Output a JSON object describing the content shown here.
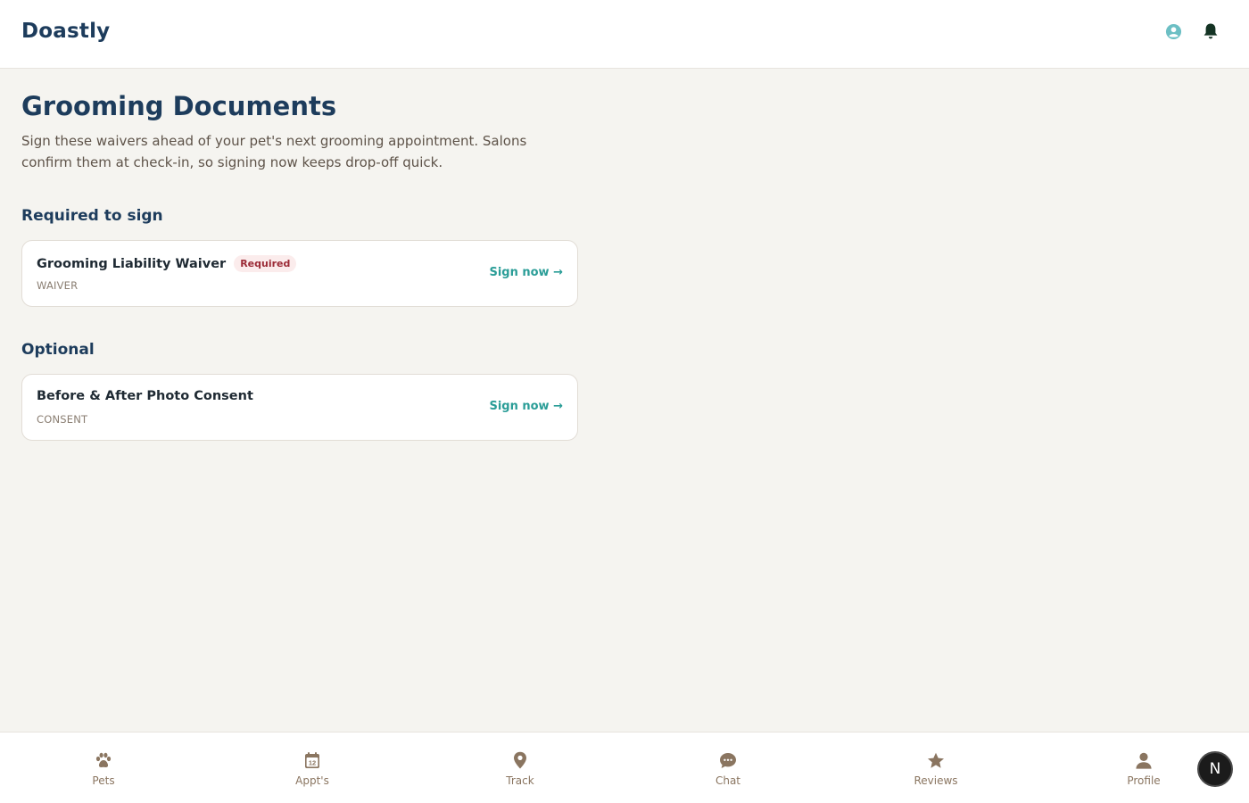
{
  "app": {
    "brand": "Doastly"
  },
  "header_icons": {
    "account": "account-circle-icon",
    "notifications": "bell-icon"
  },
  "page": {
    "title": "Grooming Documents",
    "subtitle": "Sign these waivers ahead of your pet's next grooming appointment. Salons confirm them at check-in, so signing now keeps drop-off quick."
  },
  "sections": {
    "required": {
      "heading": "Required to sign",
      "doc": {
        "title": "Grooming Liability Waiver",
        "badge": "Required",
        "type": "WAIVER",
        "action": "Sign now →"
      }
    },
    "optional": {
      "heading": "Optional",
      "doc": {
        "title": "Before & After Photo Consent",
        "type": "CONSENT",
        "action": "Sign now →"
      }
    }
  },
  "nav": {
    "items": [
      {
        "label": "Pets",
        "icon": "paw-icon"
      },
      {
        "label": "Appt's",
        "icon": "calendar-icon"
      },
      {
        "label": "Track",
        "icon": "location-pin-icon"
      },
      {
        "label": "Chat",
        "icon": "chat-bubble-icon"
      },
      {
        "label": "Reviews",
        "icon": "star-icon"
      },
      {
        "label": "Profile",
        "icon": "person-icon"
      }
    ],
    "calendar_day": "12"
  },
  "floating_button": {
    "label": "N"
  },
  "colors": {
    "brand_navy": "#1d3c5c",
    "accent_teal": "#2a9d97",
    "badge_bg": "#fbecec",
    "badge_text": "#9b2a36",
    "nav_icon": "#8a7560",
    "page_bg": "#f5f4f0"
  }
}
